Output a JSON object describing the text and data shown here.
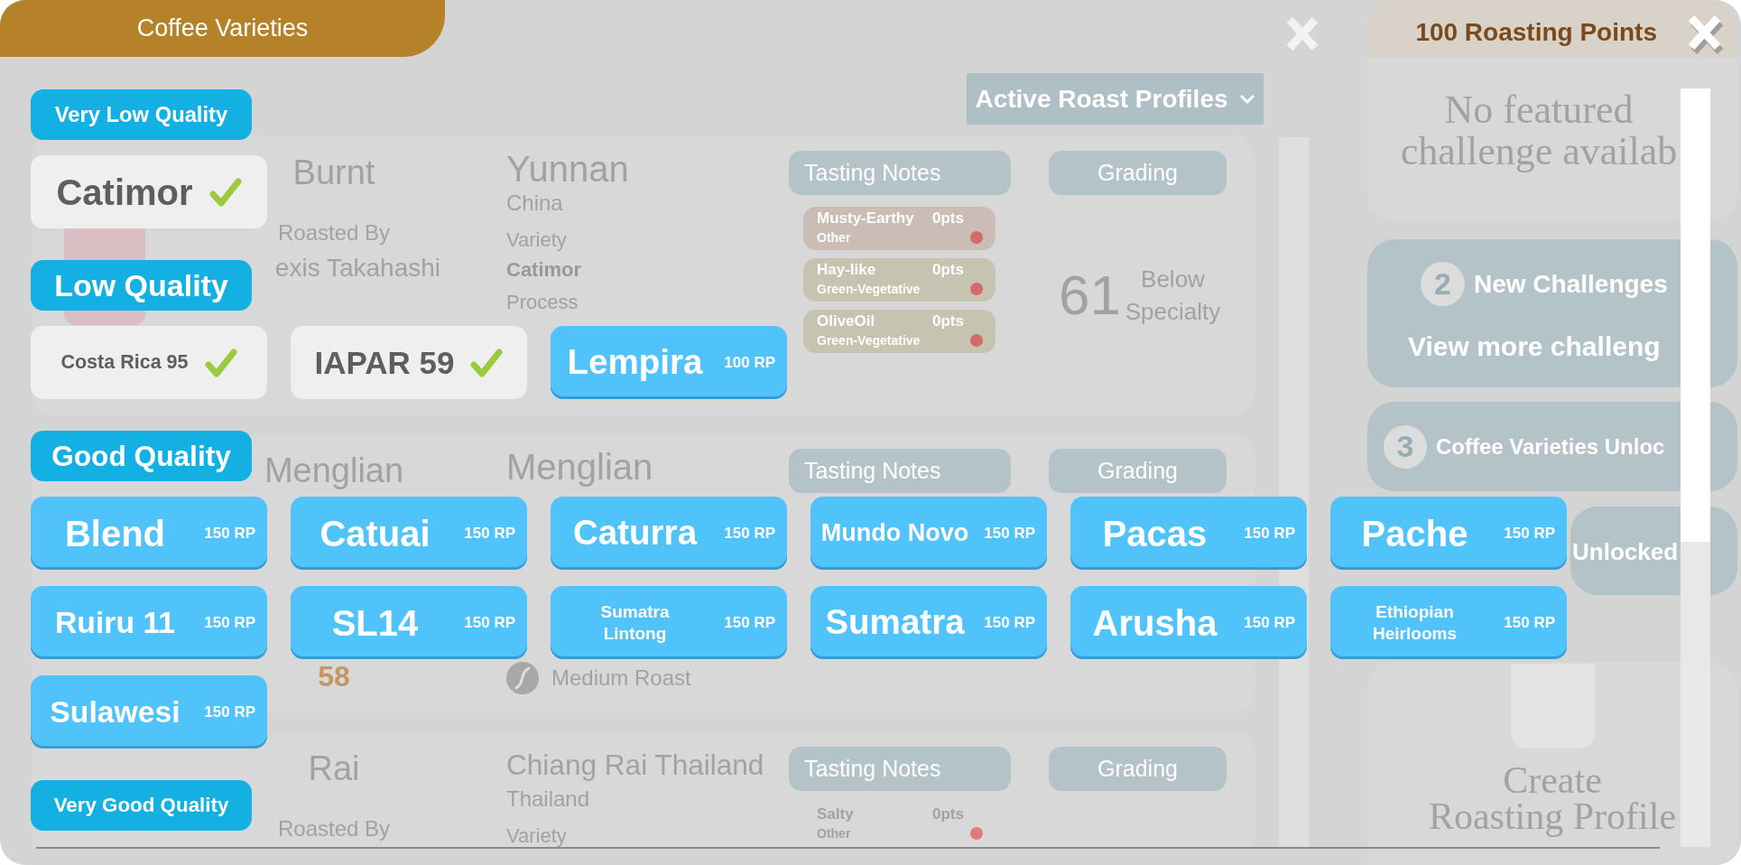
{
  "modal": {
    "title": "Coffee Varieties",
    "points": "100 Roasting Points",
    "groups": [
      {
        "label": "Very Low Quality",
        "items": [
          {
            "name": "Catimor",
            "unlocked": true
          }
        ]
      },
      {
        "label": "Low Quality",
        "items": [
          {
            "name": "Costa Rica 95",
            "unlocked": true
          },
          {
            "name": "IAPAR 59",
            "unlocked": true
          },
          {
            "name": "Lempira",
            "unlocked": false,
            "price": "100 RP"
          }
        ]
      },
      {
        "label": "Good Quality",
        "items": [
          {
            "name": "Blend",
            "unlocked": false,
            "price": "150 RP"
          },
          {
            "name": "Catuai",
            "unlocked": false,
            "price": "150 RP"
          },
          {
            "name": "Caturra",
            "unlocked": false,
            "price": "150 RP"
          },
          {
            "name": "Mundo Novo",
            "unlocked": false,
            "price": "150 RP"
          },
          {
            "name": "Pacas",
            "unlocked": false,
            "price": "150 RP"
          },
          {
            "name": "Pache",
            "unlocked": false,
            "price": "150 RP"
          },
          {
            "name": "Ruiru 11",
            "unlocked": false,
            "price": "150 RP"
          },
          {
            "name": "SL14",
            "unlocked": false,
            "price": "150 RP"
          },
          {
            "name": "Sumatra Lintong",
            "unlocked": false,
            "price": "150 RP"
          },
          {
            "name": "Sumatra",
            "unlocked": false,
            "price": "150 RP"
          },
          {
            "name": "Arusha",
            "unlocked": false,
            "price": "150 RP"
          },
          {
            "name": "Ethiopian Heirlooms",
            "unlocked": false,
            "price": "150 RP"
          },
          {
            "name": "Sulawesi",
            "unlocked": false,
            "price": "150 RP"
          }
        ]
      },
      {
        "label": "Very Good Quality"
      }
    ]
  },
  "background": {
    "profiles_button": "Active Roast Profiles",
    "profiles": [
      {
        "photo": true,
        "name": "Burnt",
        "roasted_by": "Roasted By",
        "roaster": "exis Takahashi",
        "origin": "Yunnan",
        "country": "China",
        "variety_label": "Variety",
        "variety": "Catimor",
        "process_label": "Process",
        "notes_header": "Tasting Notes",
        "notes": [
          {
            "name": "Musty-Earthy",
            "points": "0pts",
            "category": "Other",
            "color": "#cbbcb5"
          },
          {
            "name": "Hay-like",
            "points": "0pts",
            "category": "Green-Vegetative",
            "color": "#c6c3b0"
          },
          {
            "name": "OliveOil",
            "points": "0pts",
            "category": "Green-Vegetative",
            "color": "#c6c3b0"
          }
        ],
        "grading_header": "Grading",
        "score": "61",
        "grade": "Below Specialty"
      },
      {
        "name": "Menglian",
        "rating": "58",
        "origin": "Menglian",
        "roast": "Medium Roast",
        "notes_header": "Tasting Notes",
        "grading_header": "Grading"
      },
      {
        "name": "Rai",
        "roasted_by": "Roasted By",
        "origin": "Chiang Rai Thailand",
        "country": "Thailand",
        "variety_label": "Variety",
        "notes_header": "Tasting Notes",
        "notes": [
          {
            "name": "Salty",
            "points": "0pts",
            "category": "Other"
          }
        ],
        "grading_header": "Grading"
      }
    ]
  },
  "side_panel": {
    "featured": "No featured\nchallenge availab",
    "challenges": {
      "count": "2",
      "label": "New Challenges",
      "link": "View more challeng"
    },
    "unlocks": {
      "count": "3",
      "label": "Coffee Varieties Unloc"
    },
    "unlocked_label": "Unlocked",
    "create": "Create\nRoasting Profile"
  }
}
